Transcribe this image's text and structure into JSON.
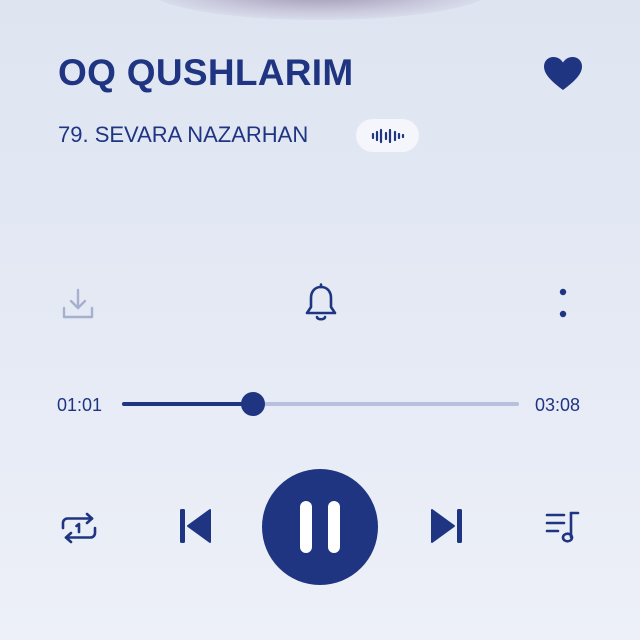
{
  "player": {
    "song_title": "OQ QUSHLARIM",
    "artist_line": "79. SEVARA NAZARHAN",
    "liked": true,
    "quality_badge_icon": "sound-wave-icon",
    "current_time": "01:01",
    "total_time": "03:08",
    "progress": 0.33,
    "state": "playing"
  },
  "actions": {
    "download_icon": "download-icon",
    "ringtone_icon": "bell-icon",
    "more_icon": "more-vertical-icon"
  },
  "controls": {
    "repeat_icon": "repeat-one-icon",
    "previous_icon": "skip-previous-icon",
    "play_pause_icon": "pause-icon",
    "next_icon": "skip-next-icon",
    "queue_icon": "queue-music-icon"
  },
  "colors": {
    "accent": "#1f3582",
    "track_inactive": "#b7c0dc",
    "disabled_icon": "#a6b0cf",
    "background": "#e4e9f4"
  }
}
